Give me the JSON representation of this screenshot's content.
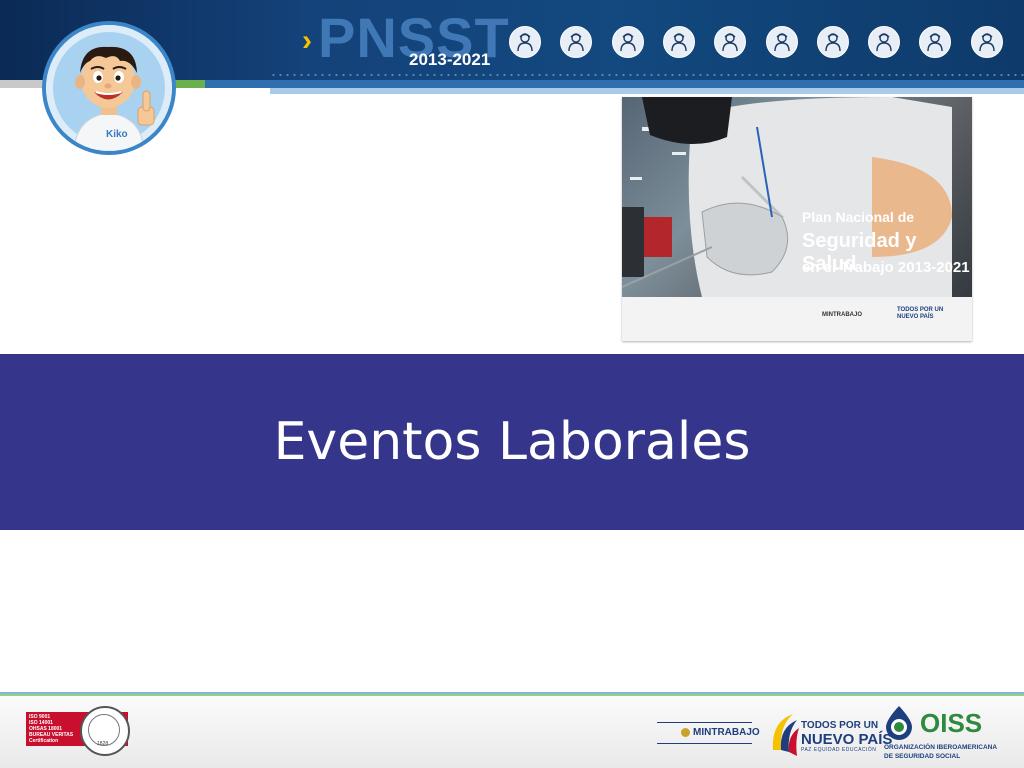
{
  "header": {
    "logo_chevron": "›",
    "logo_text": "PNSST",
    "logo_years": "2013-2021",
    "worker_icons": [
      "mining-worker-icon",
      "tractor-operator-icon",
      "electrician-icon",
      "machine-operator-icon",
      "healthcare-worker-icon",
      "oil-worker-icon",
      "construction-worker-icon",
      "firefighter-icon",
      "office-worker-icon",
      "welder-icon"
    ]
  },
  "mascot": {
    "shirt_label": "Kiko"
  },
  "cover": {
    "line1": "Plan Nacional de",
    "line2": "Seguridad y Salud",
    "line3": "en el Trabajo 2013-2021",
    "footer_left": "MINTRABAJO",
    "footer_right": "TODOS POR UN NUEVO PAÍS"
  },
  "band": {
    "title": "Eventos Laborales"
  },
  "footer": {
    "bv_lines": [
      "ISO 9001",
      "ISO 14001",
      "OHSAS 18001",
      "BUREAU VERITAS",
      "Certification"
    ],
    "bv_year": "1828",
    "mintrabajo": "MINTRABAJO",
    "todos_line1": "TODOS POR UN",
    "todos_line2": "NUEVO PAÍS",
    "todos_line3": "PAZ  EQUIDAD  EDUCACIÓN",
    "oiss_word": "OISS",
    "oiss_sub1": "ORGANIZACIÓN IBEROAMERICANA",
    "oiss_sub2": "DE SEGURIDAD SOCIAL"
  },
  "colors": {
    "band": "#35358b",
    "header_dark": "#0b2a55",
    "accent_yellow": "#f5c200",
    "oiss_green": "#2d8a3e",
    "bv_red": "#c8102e"
  }
}
